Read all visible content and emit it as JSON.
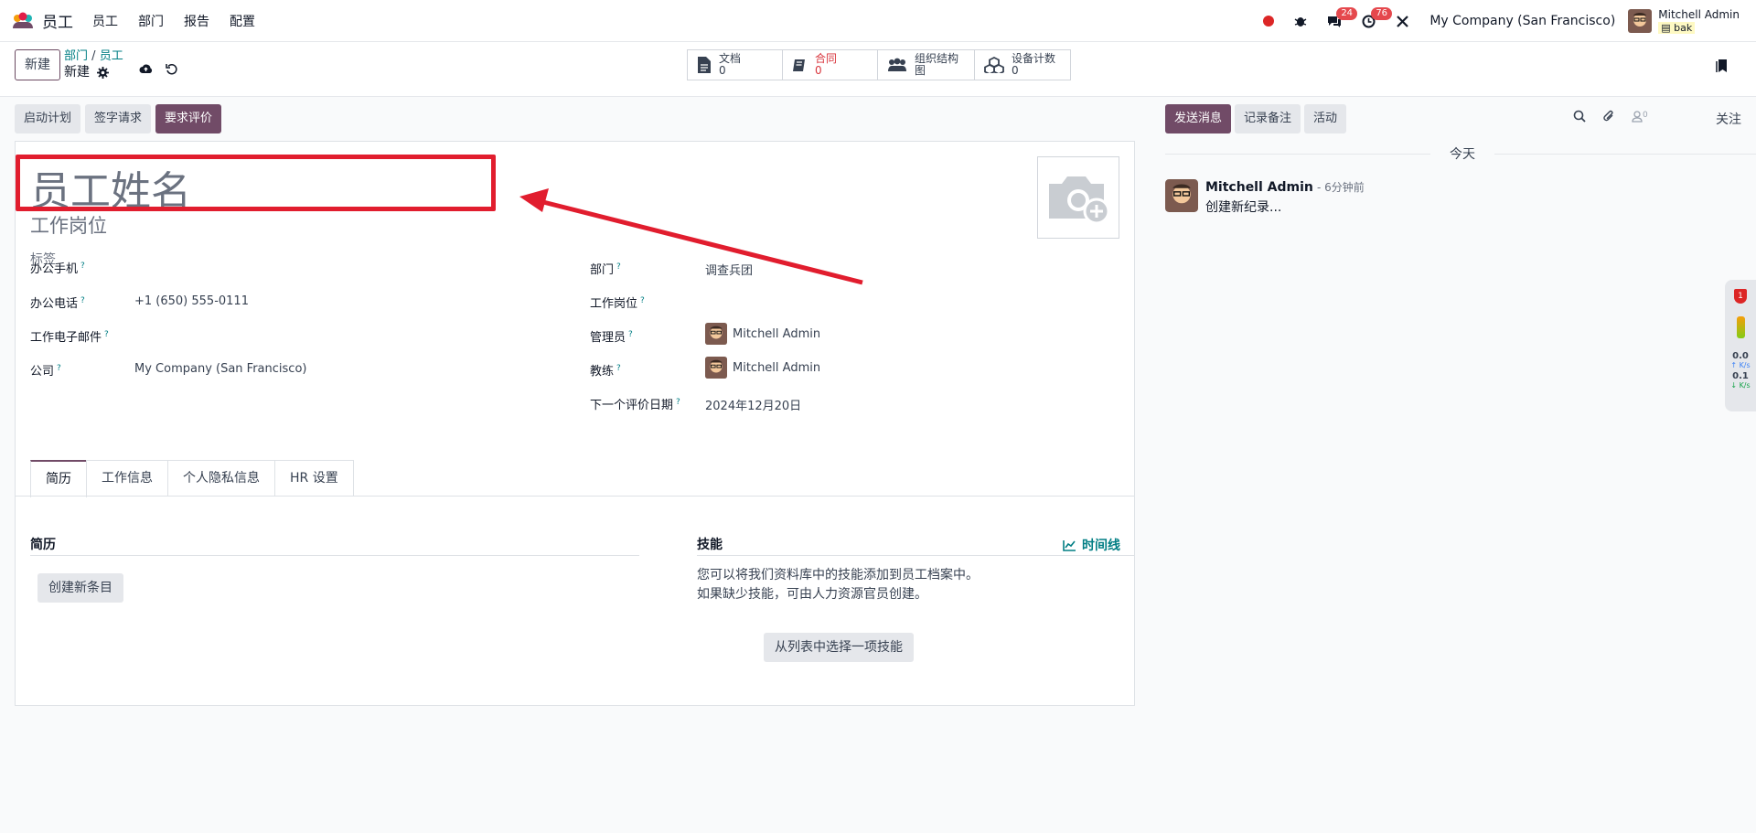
{
  "nav": {
    "app_name": "员工",
    "menu": [
      "员工",
      "部门",
      "报告",
      "配置"
    ],
    "chat_badge": "24",
    "activity_badge": "76",
    "company": "My Company (San Francisco)",
    "user_name": "Mitchell Admin",
    "user_db": "bak"
  },
  "control_panel": {
    "new_button": "新建",
    "breadcrumb": [
      "部门",
      "员工"
    ],
    "breadcrumb_sep": "/",
    "current": "新建",
    "smart_buttons": [
      {
        "label": "文档",
        "count": "0"
      },
      {
        "label": "合同",
        "count": "0"
      },
      {
        "label": "组织结构图",
        "count": ""
      },
      {
        "label": "设备计数",
        "count": "0"
      }
    ]
  },
  "statusbar": {
    "buttons": [
      "启动计划",
      "签字请求",
      "要求评价"
    ]
  },
  "form": {
    "name_placeholder": "员工姓名",
    "job_title_placeholder": "工作岗位",
    "tags_placeholder": "标签",
    "left_fields": [
      {
        "label": "办公手机",
        "value": ""
      },
      {
        "label": "办公电话",
        "value": "+1 (650) 555-0111"
      },
      {
        "label": "工作电子邮件",
        "value": ""
      },
      {
        "label": "公司",
        "value": "My Company (San Francisco)"
      }
    ],
    "right_fields": [
      {
        "label": "部门",
        "value": "调查兵团"
      },
      {
        "label": "工作岗位",
        "value": ""
      },
      {
        "label": "管理员",
        "value": "Mitchell Admin"
      },
      {
        "label": "教练",
        "value": "Mitchell Admin"
      },
      {
        "label": "下一个评价日期",
        "value": "2024年12月20日"
      }
    ],
    "help_mark": "?",
    "tabs": [
      "简历",
      "工作信息",
      "个人隐私信息",
      "HR 设置"
    ],
    "resume_title": "简历",
    "resume_button": "创建新条目",
    "skills_title": "技能",
    "timeline_label": "时间线",
    "skills_help": [
      "您可以将我们资料库中的技能添加到员工档案中。",
      "如果缺少技能，可由人力资源官员创建。"
    ],
    "skills_button": "从列表中选择一项技能"
  },
  "chatter": {
    "send_message": "发送消息",
    "log_note": "记录备注",
    "activity": "活动",
    "followers_count": "0",
    "follow": "关注",
    "today": "今天",
    "message": {
      "author": "Mitchell Admin",
      "time": "- 6分钟前",
      "body": "创建新纪录..."
    }
  },
  "side_widget": {
    "badge": "1",
    "up": "0.0",
    "down": "0.1",
    "unit": "K/s"
  },
  "colors": {
    "primary": "#714b67",
    "link": "#017e84",
    "annotation": "#e11d2e"
  }
}
